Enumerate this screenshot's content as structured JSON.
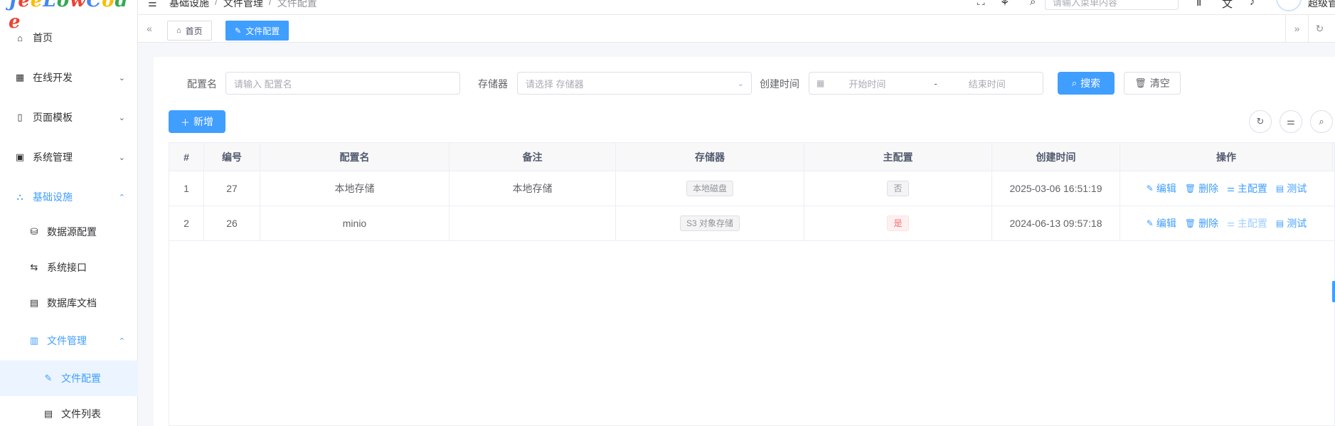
{
  "app": {
    "logo_letters": [
      "J",
      "e",
      "e",
      "L",
      "o",
      "w",
      "C",
      "o",
      "d",
      "e"
    ],
    "logo_colors": [
      "#4285f4",
      "#ea4335",
      "#fbbc05",
      "#4285f4",
      "#34a853",
      "#ea4335",
      "#4285f4",
      "#fbbc05",
      "#34a853",
      "#ea4335"
    ]
  },
  "sidebar": {
    "items": [
      {
        "label": "首页",
        "icon": "home-icon",
        "glyph": "⌂",
        "arrow": ""
      },
      {
        "label": "在线开发",
        "icon": "code-grid-icon",
        "glyph": "▦",
        "arrow": "⌄"
      },
      {
        "label": "页面模板",
        "icon": "tablet-icon",
        "glyph": "▯",
        "arrow": "⌄"
      },
      {
        "label": "系统管理",
        "icon": "grid-icon",
        "glyph": "▣",
        "arrow": "⌄"
      },
      {
        "label": "基础设施",
        "icon": "sitemap-icon",
        "glyph": "⛬",
        "arrow": "⌃"
      },
      {
        "label": "数据源配置",
        "icon": "database-icon",
        "glyph": "⛁",
        "arrow": ""
      },
      {
        "label": "系统接口",
        "icon": "api-icon",
        "glyph": "⇆",
        "arrow": ""
      },
      {
        "label": "数据库文档",
        "icon": "doc-icon",
        "glyph": "▤",
        "arrow": ""
      },
      {
        "label": "文件管理",
        "icon": "file-icon",
        "glyph": "▥",
        "arrow": "⌃"
      },
      {
        "label": "文件配置",
        "icon": "edit-icon",
        "glyph": "✎",
        "arrow": ""
      },
      {
        "label": "文件列表",
        "icon": "file-list-icon",
        "glyph": "▤",
        "arrow": ""
      }
    ]
  },
  "header": {
    "breadcrumb": [
      "基础设施",
      "/",
      "文件管理",
      "/",
      "文件配置"
    ],
    "menu_search_placeholder": "请输入菜单内容",
    "username": "超级管"
  },
  "tabs": [
    {
      "label": "首页",
      "glyph": "⌂"
    },
    {
      "label": "文件配置",
      "glyph": "✎"
    }
  ],
  "search_form": {
    "name_label": "配置名",
    "name_placeholder": "请输入 配置名",
    "storage_label": "存储器",
    "storage_placeholder": "请选择 存储器",
    "time_label": "创建时间",
    "start_placeholder": "开始时间",
    "range_sep": "-",
    "end_placeholder": "结束时间",
    "search_button": "搜索",
    "clear_button": "清空"
  },
  "toolbar": {
    "add_button": "新增"
  },
  "table": {
    "columns": [
      "#",
      "编号",
      "配置名",
      "备注",
      "存储器",
      "主配置",
      "创建时间",
      "操作"
    ],
    "rows": [
      {
        "idx": "1",
        "id": "27",
        "name": "本地存储",
        "remark": "本地存储",
        "storage": "本地磁盘",
        "master": "否",
        "master_danger": false,
        "created": "2025-03-06 16:51:19",
        "master_op_disabled": false
      },
      {
        "idx": "2",
        "id": "26",
        "name": "minio",
        "remark": "",
        "storage": "S3 对象存储",
        "master": "是",
        "master_danger": true,
        "created": "2024-06-13 09:57:18",
        "master_op_disabled": true
      }
    ],
    "ops": {
      "edit": "编辑",
      "delete": "删除",
      "master": "主配置",
      "test": "测试"
    }
  }
}
